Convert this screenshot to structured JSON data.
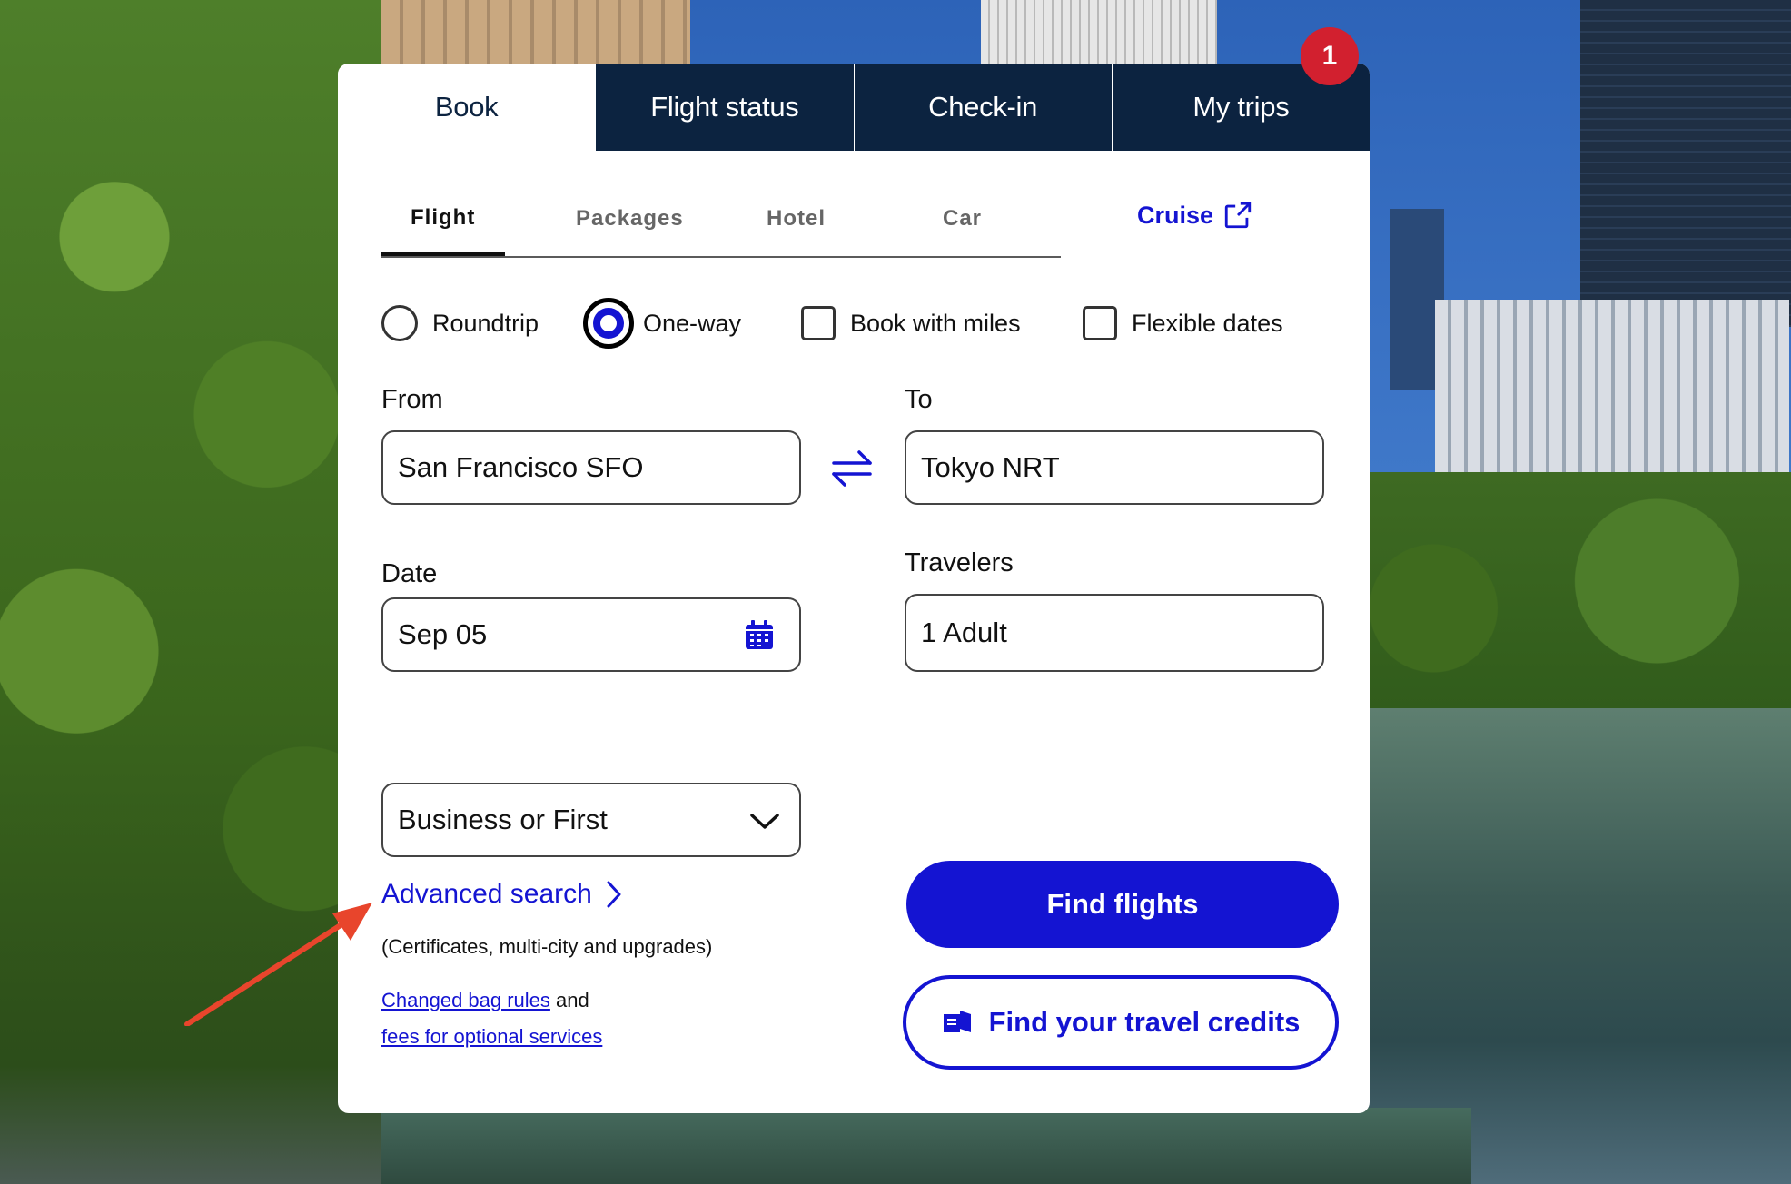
{
  "top_tabs": [
    {
      "label": "Book"
    },
    {
      "label": "Flight status"
    },
    {
      "label": "Check-in"
    },
    {
      "label": "My trips"
    }
  ],
  "notification_badge": "1",
  "sub_tabs": [
    {
      "label": "Flight"
    },
    {
      "label": "Packages"
    },
    {
      "label": "Hotel"
    },
    {
      "label": "Car"
    }
  ],
  "cruise_label": "Cruise",
  "trip_options": {
    "roundtrip": "Roundtrip",
    "one_way": "One-way",
    "book_with_miles": "Book with miles",
    "flexible_dates": "Flexible dates",
    "selected": "One-way"
  },
  "from": {
    "label": "From",
    "value": "San Francisco SFO"
  },
  "to": {
    "label": "To",
    "value": "Tokyo NRT"
  },
  "date": {
    "label": "Date",
    "value": "Sep 05"
  },
  "travelers": {
    "label": "Travelers",
    "value": "1 Adult"
  },
  "cabin": {
    "value": "Business or First"
  },
  "advanced_search": {
    "label": "Advanced search",
    "sub": "(Certificates, multi-city and upgrades)"
  },
  "bag": {
    "link1": "Changed bag rules",
    "connector": "and",
    "link2": "fees for optional services"
  },
  "buttons": {
    "find_flights": "Find flights",
    "travel_credits": "Find your travel credits"
  },
  "colors": {
    "navy": "#0c2340",
    "brand_blue": "#1414d2",
    "badge_red": "#d2202f",
    "arrow_red": "#e8452c"
  }
}
